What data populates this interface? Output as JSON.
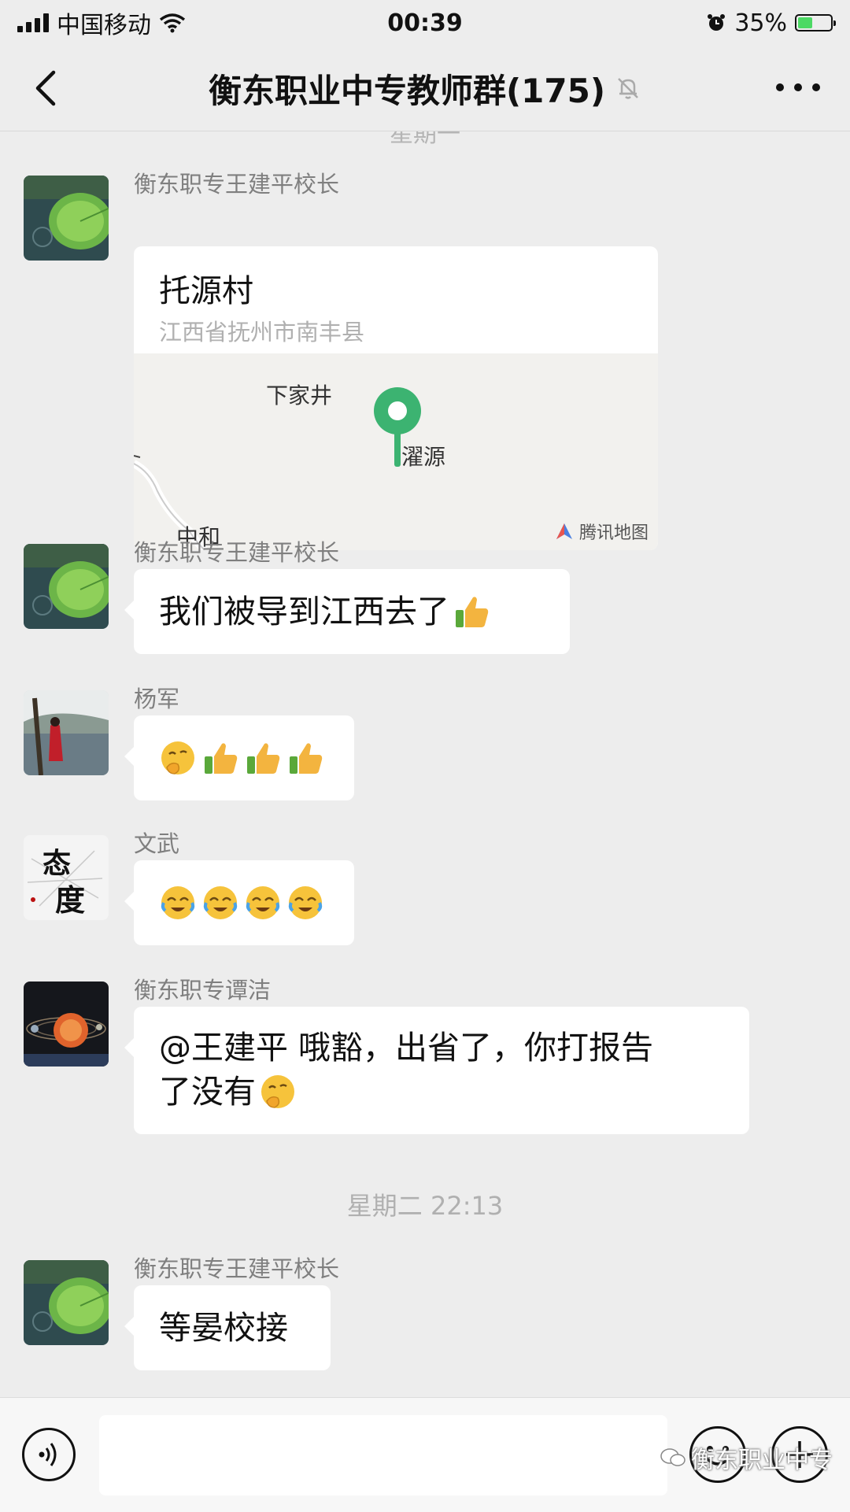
{
  "status": {
    "carrier": "中国移动",
    "time": "00:39",
    "battery": "35%"
  },
  "header": {
    "title": "衡东职业中专教师群(175)"
  },
  "chat": {
    "cutoff_time": "星期一",
    "messages": [
      {
        "sender": "衡东职专王建平校长",
        "type": "location",
        "place": "托源村",
        "address": "江西省抚州市南丰县",
        "map_labels": [
          "下家井",
          "濯源",
          "中和"
        ],
        "map_brand": "腾讯地图"
      },
      {
        "sender": "衡东职专王建平校长",
        "text": "我们被导到江西去了",
        "trailing_emoji": [
          "thumbs-up"
        ]
      },
      {
        "sender": "杨军",
        "emoji": [
          "thinking",
          "thumbs-up",
          "thumbs-up",
          "thumbs-up"
        ]
      },
      {
        "sender": "文武",
        "emoji": [
          "crying-laugh",
          "crying-laugh",
          "crying-laugh",
          "crying-laugh"
        ]
      },
      {
        "sender": "衡东职专谭洁",
        "text_line1": "@王建平 哦豁，出省了，你打报告",
        "text_line2": "了没有",
        "trailing_emoji": [
          "thinking"
        ]
      },
      {
        "sender": "衡东职专王建平校长",
        "text": "等晏校接"
      }
    ],
    "time_separator": "星期二 22:13"
  },
  "watermark": "衡东职业中专",
  "colors": {
    "background": "#ededed",
    "bubble": "#ffffff",
    "map_pin": "#3cb371"
  }
}
